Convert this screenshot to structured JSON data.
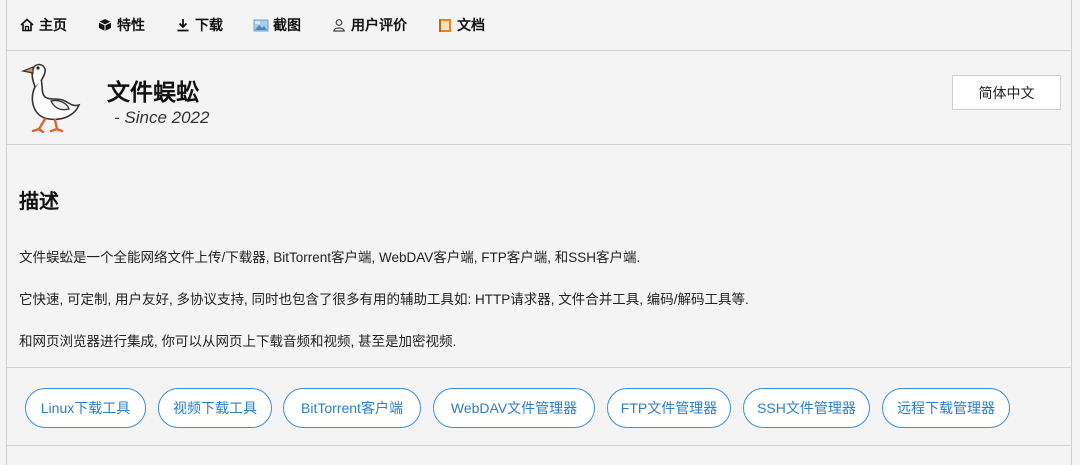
{
  "nav": {
    "items": [
      {
        "label": "主页",
        "icon": "home-icon"
      },
      {
        "label": "特性",
        "icon": "cube-icon"
      },
      {
        "label": "下载",
        "icon": "download-icon"
      },
      {
        "label": "截图",
        "icon": "screenshot-icon"
      },
      {
        "label": "用户评价",
        "icon": "user-icon"
      },
      {
        "label": "文档",
        "icon": "book-icon"
      }
    ]
  },
  "header": {
    "title": "文件蜈蚣",
    "subtitle": "- Since 2022",
    "lang_button": "简体中文"
  },
  "description": {
    "title": "描述",
    "lines": [
      "文件蜈蚣是一个全能网络文件上传/下载器, BitTorrent客户端, WebDAV客户端, FTP客户端, 和SSH客户端.",
      "它快速, 可定制, 用户友好, 多协议支持, 同时也包含了很多有用的辅助工具如: HTTP请求器, 文件合并工具, 编码/解码工具等.",
      "和网页浏览器进行集成, 你可以从网页上下载音频和视频, 甚至是加密视频."
    ]
  },
  "tags": [
    "Linux下载工具",
    "视频下载工具",
    "BitTorrent客户端",
    "WebDAV文件管理器",
    "FTP文件管理器",
    "SSH文件管理器",
    "远程下载管理器"
  ],
  "colors": {
    "accent": "#2d7fc4",
    "border": "#3b8fd0",
    "background": "#f4f4f4"
  }
}
